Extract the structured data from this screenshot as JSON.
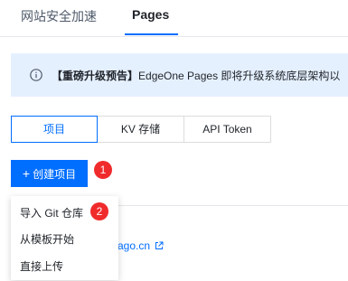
{
  "top_tabs": [
    {
      "label": "网站安全加速",
      "active": false
    },
    {
      "label": "Pages",
      "active": true
    }
  ],
  "notice": {
    "icon": "info-circle-icon",
    "highlight": "【重磅升级预告】",
    "text": "EdgeOne Pages 即将升级系统底层架构以"
  },
  "segment_tabs": [
    {
      "label": "项目",
      "active": true
    },
    {
      "label": "KV 存储",
      "active": false
    },
    {
      "label": "API Token",
      "active": false
    }
  ],
  "create_button": {
    "icon": "plus-icon",
    "label": "创建项目"
  },
  "badges": {
    "step1": "1",
    "step2": "2"
  },
  "dropdown": {
    "items": [
      {
        "label": "导入 Git 仓库"
      },
      {
        "label": "从模板开始"
      },
      {
        "label": "直接上传"
      }
    ]
  },
  "background_link": {
    "text": "ago.cn",
    "icon": "external-link-icon"
  },
  "colors": {
    "accent": "#006eff",
    "badge": "#f02b2b",
    "notice_bg": "#e5f0ff"
  }
}
